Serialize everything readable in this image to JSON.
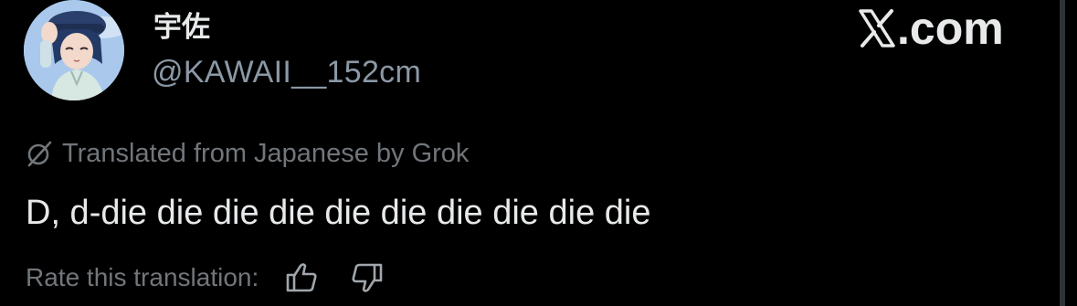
{
  "user": {
    "display_name": "宇佐",
    "handle": "@KAWAII__152cm",
    "avatar_icon": "anime-character-avatar"
  },
  "watermark": {
    "text": ".com",
    "icon": "x-logo-icon"
  },
  "translation": {
    "notice": "Translated from Japanese by Grok",
    "icon": "grok-icon"
  },
  "post": {
    "text": "D, d-die die die die die die die die die die"
  },
  "rating": {
    "label": "Rate this translation:",
    "thumbs_up_icon": "thumbs-up-icon",
    "thumbs_down_icon": "thumbs-down-icon"
  },
  "colors": {
    "background": "#000000",
    "primary_text": "#e7e9ea",
    "secondary_text": "#71767b",
    "handle_text": "#8b98a5"
  }
}
